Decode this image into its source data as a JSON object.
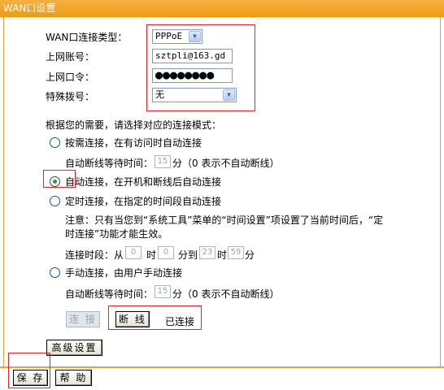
{
  "title": "WAN口设置",
  "form": {
    "conn_type_label": "WAN口连接类型：",
    "conn_type_value": "PPPoE",
    "account_label": "上网账号：",
    "account_value": "sztpli@163.gd",
    "password_label": "上网口令：",
    "password_mask": "●●●●●●●●",
    "dial_label": "特殊拨号：",
    "dial_value": "无"
  },
  "mode": {
    "heading": "根据您的需要，请选择对应的连接模式：",
    "on_demand_label": "按需连接，在有访问时自动连接",
    "idle1_prefix": "自动断线等待时间：",
    "idle1_value": "15",
    "idle1_suffix": "分（0 表示不自动断线）",
    "auto_label": "自动连接，在开机和断线后自动连接",
    "timed_label": "定时连接，在指定的时间段自动连接",
    "note_line1": "注意：只有当您到“系统工具”菜单的“时间设置”项设置了当前时间后，“定",
    "note_line2": "时连接”功能才能生效。",
    "period_prefix": "连接时段：从",
    "period_from_h": "0",
    "period_h1": "时",
    "period_from_m": "0",
    "period_m_to": "分到",
    "period_to_h": "23",
    "period_h2": "时",
    "period_to_m": "59",
    "period_m2": "分",
    "manual_label": "手动连接，由用户手动连接",
    "idle2_prefix": "自动断线等待时间：",
    "idle2_value": "15",
    "idle2_suffix": "分（0 表示不自动断线）"
  },
  "actions": {
    "connect": "连 接",
    "disconnect": "断 线",
    "status": "已连接",
    "advanced": "高级设置",
    "save": "保 存",
    "help": "帮 助"
  },
  "colors": {
    "accent": "#f5a623",
    "highlight_box": "#e0242a"
  }
}
